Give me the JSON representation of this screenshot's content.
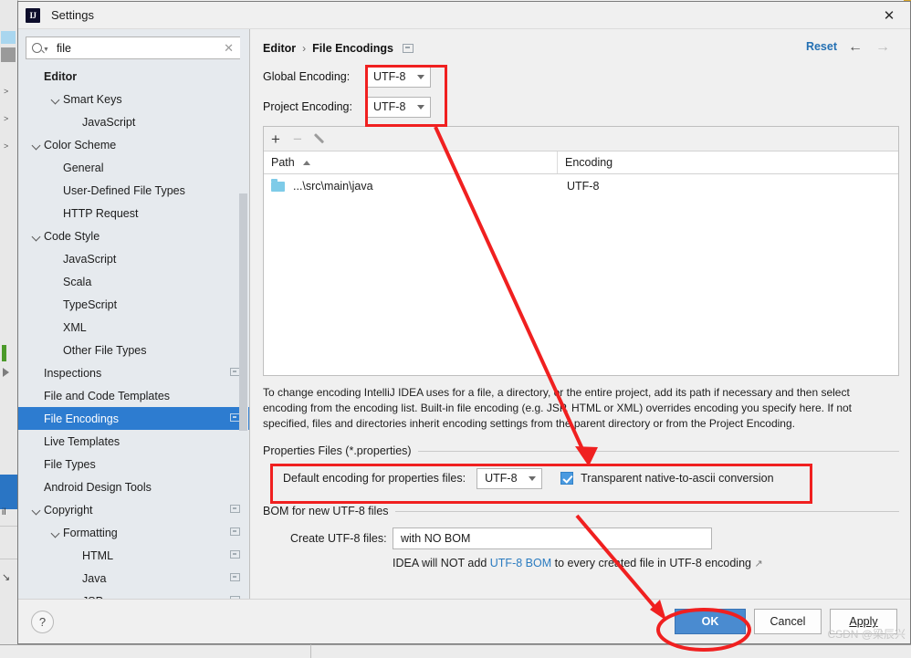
{
  "window": {
    "title": "Settings",
    "logo_text": "IJ",
    "close_icon": "✕"
  },
  "search": {
    "value": "file",
    "placeholder": "Search settings",
    "clear_icon": "✕",
    "search_icon": "search-icon"
  },
  "sidebar": {
    "items": [
      {
        "label": "Editor",
        "indent": 0,
        "bold": true,
        "arrow": "none",
        "selected": false,
        "scope": false
      },
      {
        "label": "Smart Keys",
        "indent": 1,
        "bold": false,
        "arrow": "open",
        "selected": false,
        "scope": false
      },
      {
        "label": "JavaScript",
        "indent": 2,
        "bold": false,
        "arrow": "none",
        "selected": false,
        "scope": false
      },
      {
        "label": "Color Scheme",
        "indent": 0,
        "bold": false,
        "arrow": "open",
        "selected": false,
        "scope": false
      },
      {
        "label": "General",
        "indent": 1,
        "bold": false,
        "arrow": "none",
        "selected": false,
        "scope": false
      },
      {
        "label": "User-Defined File Types",
        "indent": 1,
        "bold": false,
        "arrow": "none",
        "selected": false,
        "scope": false
      },
      {
        "label": "HTTP Request",
        "indent": 1,
        "bold": false,
        "arrow": "none",
        "selected": false,
        "scope": false
      },
      {
        "label": "Code Style",
        "indent": 0,
        "bold": false,
        "arrow": "open",
        "selected": false,
        "scope": false
      },
      {
        "label": "JavaScript",
        "indent": 1,
        "bold": false,
        "arrow": "none",
        "selected": false,
        "scope": false
      },
      {
        "label": "Scala",
        "indent": 1,
        "bold": false,
        "arrow": "none",
        "selected": false,
        "scope": false
      },
      {
        "label": "TypeScript",
        "indent": 1,
        "bold": false,
        "arrow": "none",
        "selected": false,
        "scope": false
      },
      {
        "label": "XML",
        "indent": 1,
        "bold": false,
        "arrow": "none",
        "selected": false,
        "scope": false
      },
      {
        "label": "Other File Types",
        "indent": 1,
        "bold": false,
        "arrow": "none",
        "selected": false,
        "scope": false
      },
      {
        "label": "Inspections",
        "indent": 0,
        "bold": false,
        "arrow": "none",
        "selected": false,
        "scope": true
      },
      {
        "label": "File and Code Templates",
        "indent": 0,
        "bold": false,
        "arrow": "none",
        "selected": false,
        "scope": false
      },
      {
        "label": "File Encodings",
        "indent": 0,
        "bold": false,
        "arrow": "none",
        "selected": true,
        "scope": true
      },
      {
        "label": "Live Templates",
        "indent": 0,
        "bold": false,
        "arrow": "none",
        "selected": false,
        "scope": false
      },
      {
        "label": "File Types",
        "indent": 0,
        "bold": false,
        "arrow": "none",
        "selected": false,
        "scope": false
      },
      {
        "label": "Android Design Tools",
        "indent": 0,
        "bold": false,
        "arrow": "none",
        "selected": false,
        "scope": false
      },
      {
        "label": "Copyright",
        "indent": 0,
        "bold": false,
        "arrow": "open",
        "selected": false,
        "scope": true
      },
      {
        "label": "Formatting",
        "indent": 1,
        "bold": false,
        "arrow": "open",
        "selected": false,
        "scope": true
      },
      {
        "label": "HTML",
        "indent": 2,
        "bold": false,
        "arrow": "none",
        "selected": false,
        "scope": true
      },
      {
        "label": "Java",
        "indent": 2,
        "bold": false,
        "arrow": "none",
        "selected": false,
        "scope": true
      },
      {
        "label": "JSP",
        "indent": 2,
        "bold": false,
        "arrow": "none",
        "selected": false,
        "scope": true
      }
    ]
  },
  "main": {
    "breadcrumb": {
      "parent": "Editor",
      "separator": "›",
      "current": "File Encodings"
    },
    "reset_label": "Reset",
    "nav_back_icon": "←",
    "nav_forward_icon": "→",
    "global_encoding": {
      "label": "Global Encoding:",
      "value": "UTF-8"
    },
    "project_encoding": {
      "label": "Project Encoding:",
      "value": "UTF-8"
    },
    "table": {
      "toolbar": {
        "add_icon": "+",
        "remove_icon": "−",
        "edit_icon": "pencil-icon"
      },
      "columns": [
        "Path",
        "Encoding"
      ],
      "sort_column": "Path",
      "sort_direction": "ascending",
      "rows": [
        {
          "path": "...\\src\\main\\java",
          "encoding": "UTF-8"
        }
      ]
    },
    "help_text": "To change encoding IntelliJ IDEA uses for a file, a directory, or the entire project, add its path if necessary and then select encoding from the encoding list. Built-in file encoding (e.g. JSP, HTML or XML) overrides encoding you specify here. If not specified, files and directories inherit encoding settings from the parent directory or from the Project Encoding.",
    "properties_group": {
      "title": "Properties Files (*.properties)",
      "default_encoding_label": "Default encoding for properties files:",
      "default_encoding_value": "UTF-8",
      "transparent_label": "Transparent native-to-ascii conversion",
      "transparent_checked": true
    },
    "bom_group": {
      "title": "BOM for new UTF-8 files",
      "create_label": "Create UTF-8 files:",
      "create_value": "with NO BOM",
      "note_prefix": "IDEA will NOT add ",
      "note_link": "UTF-8 BOM",
      "note_suffix": " to every created file in UTF-8 encoding ",
      "note_external_icon": "↗"
    }
  },
  "footer": {
    "help_icon": "?",
    "ok_label": "OK",
    "cancel_label": "Cancel",
    "apply_label": "Apply"
  },
  "watermark": "CSDN @梁辰兴",
  "colors": {
    "accent_blue": "#2d7cd0",
    "primary_button": "#4a8bd0",
    "link_blue": "#2a7bc0",
    "annotation_red": "#f02020",
    "sidebar_bg": "#e6eaee",
    "panel_bg": "#f0f0f0"
  }
}
